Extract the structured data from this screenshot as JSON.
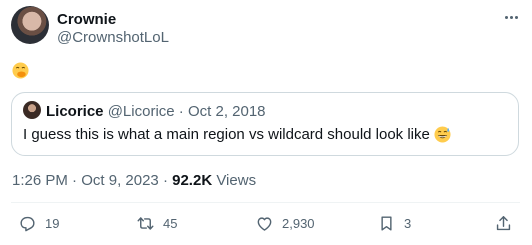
{
  "author": {
    "name": "Crownie",
    "handle": "@CrownshotLoL"
  },
  "tweet": {
    "emoji_icon": "hand-over-mouth-emoji"
  },
  "quote": {
    "name": "Licorice",
    "handle": "@Licorice",
    "separator": "·",
    "date": "Oct 2, 2018",
    "text": "I guess this is what a main region vs wildcard should look like",
    "emoji_icon": "grinning-sweat-emoji"
  },
  "meta": {
    "time": "1:26 PM",
    "separator": "·",
    "date": "Oct 9, 2023",
    "views_count": "92.2K",
    "views_label": "Views"
  },
  "actions": {
    "replies": "19",
    "reposts": "45",
    "likes": "2,930",
    "bookmarks": "3"
  },
  "colors": {
    "text": "#0f1419",
    "muted": "#536471",
    "border": "#cfd9de",
    "emoji_yellow": "#ffcc4d"
  }
}
